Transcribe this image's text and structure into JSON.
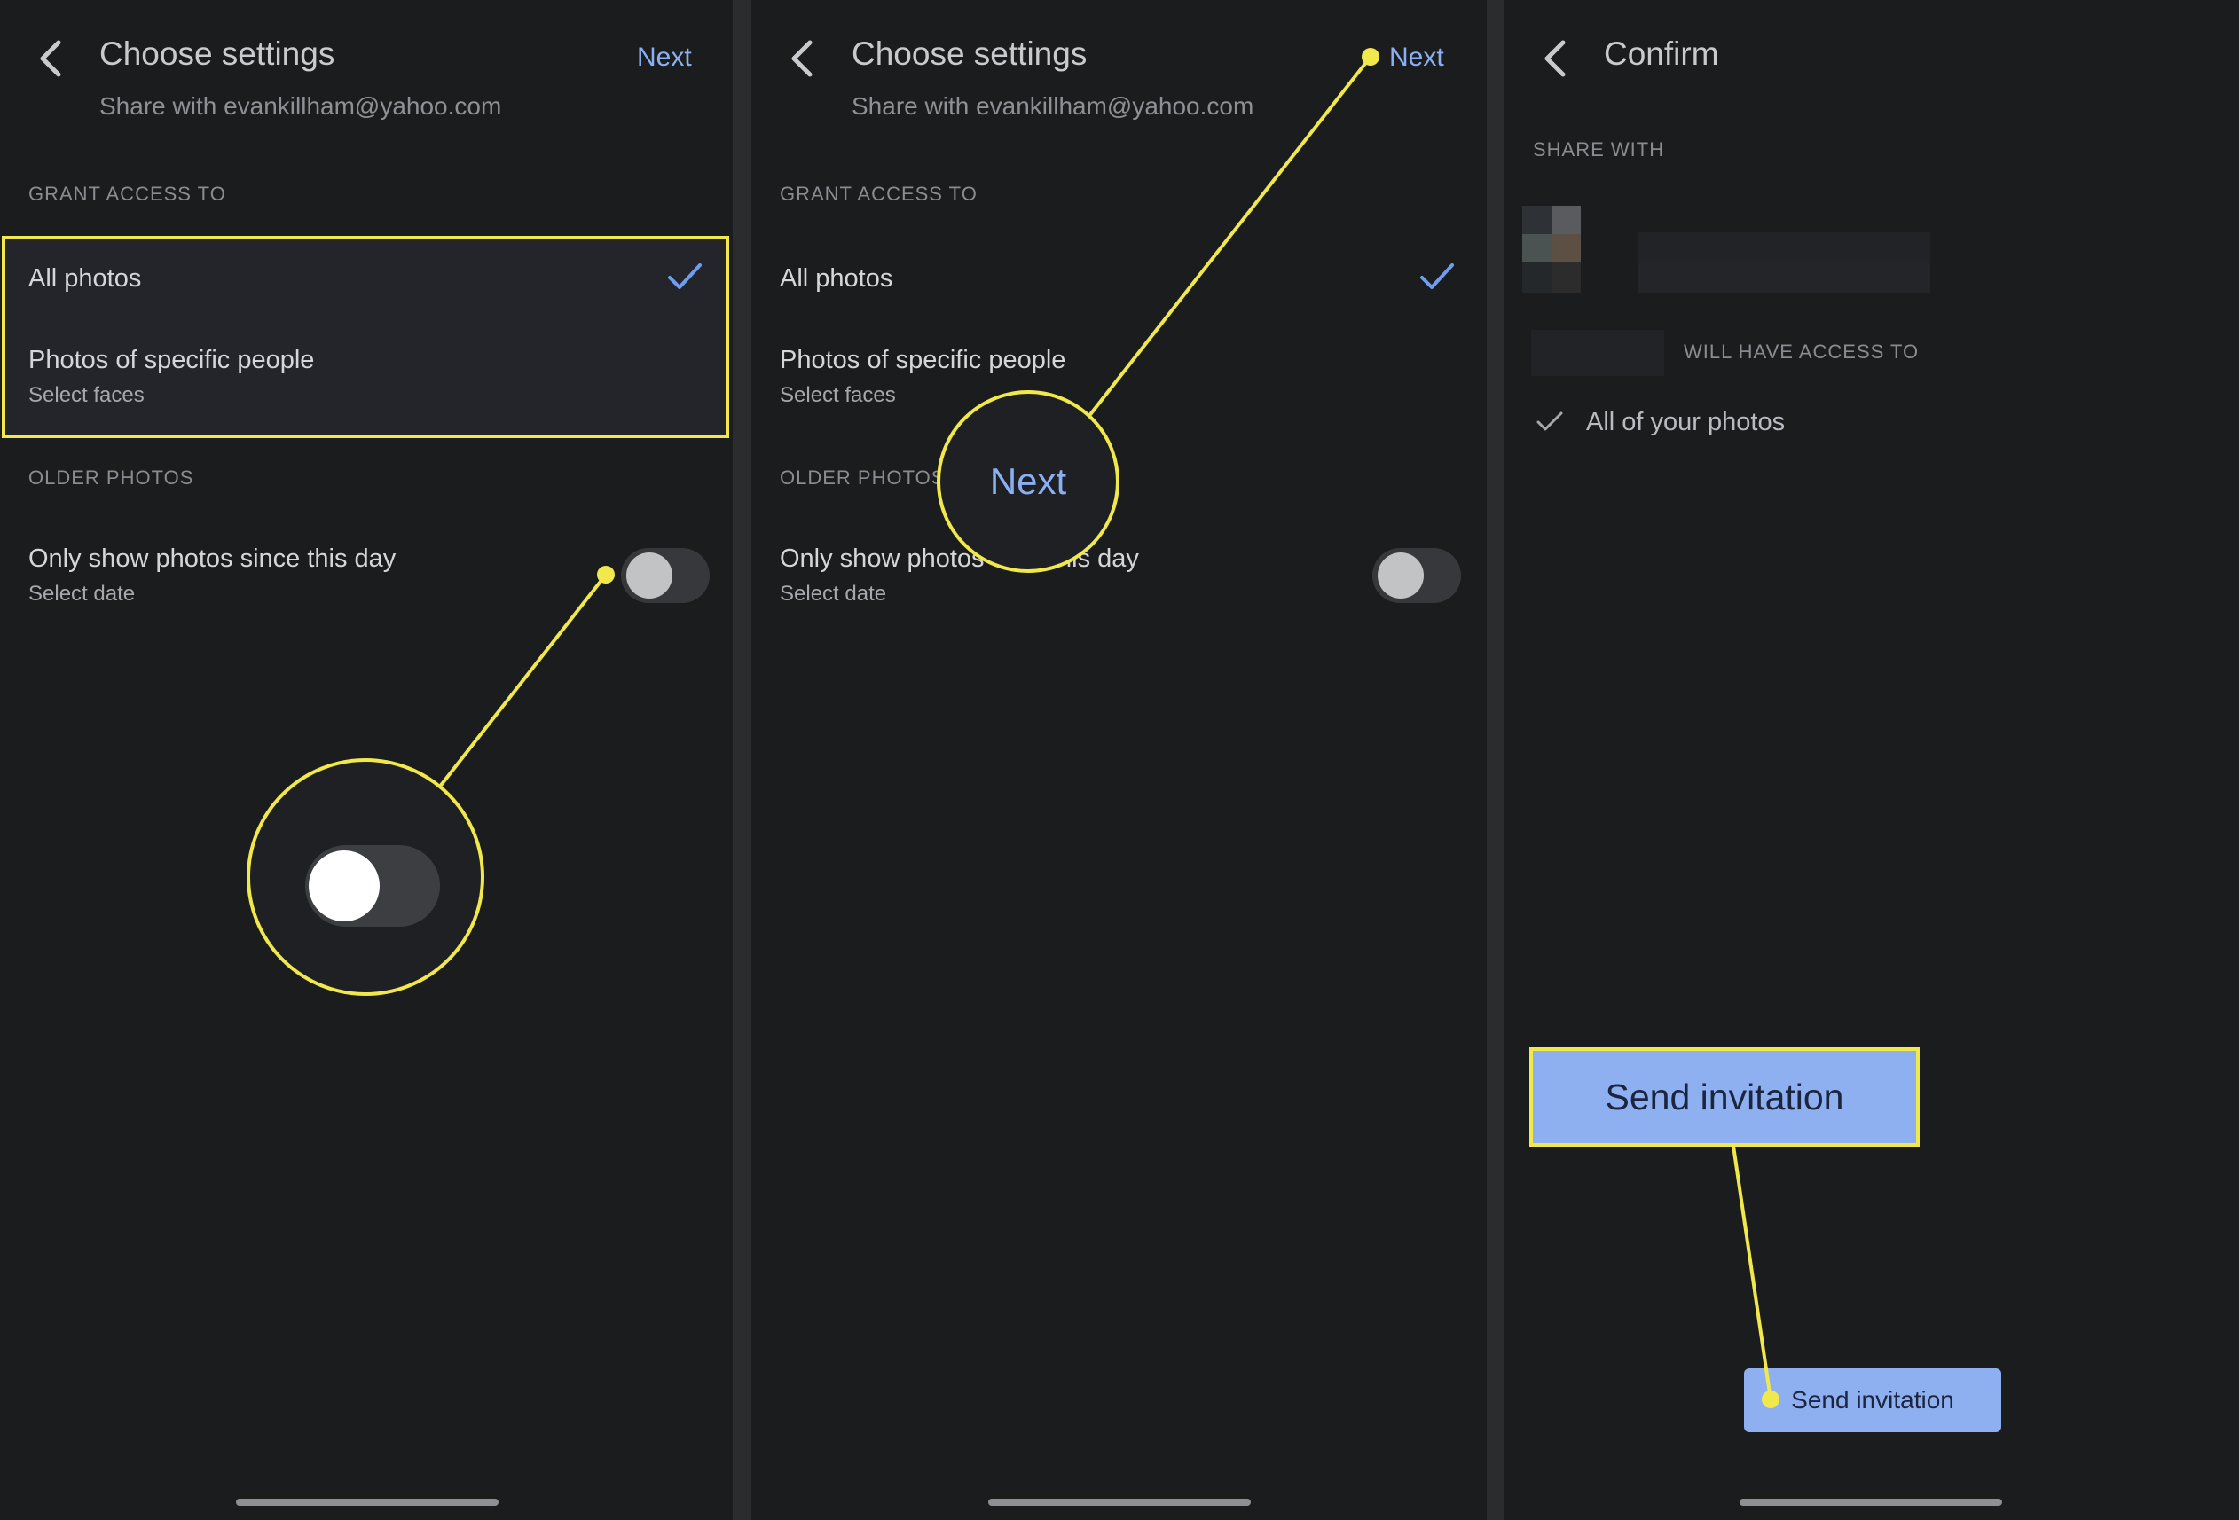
{
  "panels": [
    {
      "title": "Choose settings",
      "subtitle": "Share with evankillham@yahoo.com",
      "next_label": "Next",
      "grant_access_label": "GRANT ACCESS TO",
      "options": [
        {
          "label": "All photos",
          "selected": true
        },
        {
          "label": "Photos of specific people",
          "sub": "Select faces"
        }
      ],
      "older_photos_label": "OLDER PHOTOS",
      "older_row": {
        "label": "Only show photos since this day",
        "sub": "Select date",
        "toggle_on": false
      }
    },
    {
      "title": "Choose settings",
      "subtitle": "Share with evankillham@yahoo.com",
      "next_label": "Next",
      "grant_access_label": "GRANT ACCESS TO",
      "options": [
        {
          "label": "All photos",
          "selected": true
        },
        {
          "label": "Photos of specific people",
          "sub": "Select faces"
        }
      ],
      "older_photos_label": "OLDER PHOTOS",
      "older_row": {
        "label_start": "Only show photos",
        "label_end": "nis day",
        "sub": "Select date",
        "toggle_on": false
      },
      "zoom_label": "Next"
    },
    {
      "title": "Confirm",
      "share_with_label": "SHARE WITH",
      "will_have_access_label": "WILL HAVE ACCESS TO",
      "access_item": "All of your photos",
      "send_button_label": "Send invitation",
      "send_callout_label": "Send invitation"
    }
  ],
  "colors": {
    "background": "#1b1c1e",
    "accent_blue": "#8ab0f2",
    "callout_yellow": "#f1e84b",
    "send_button": "#8eb0f0"
  }
}
